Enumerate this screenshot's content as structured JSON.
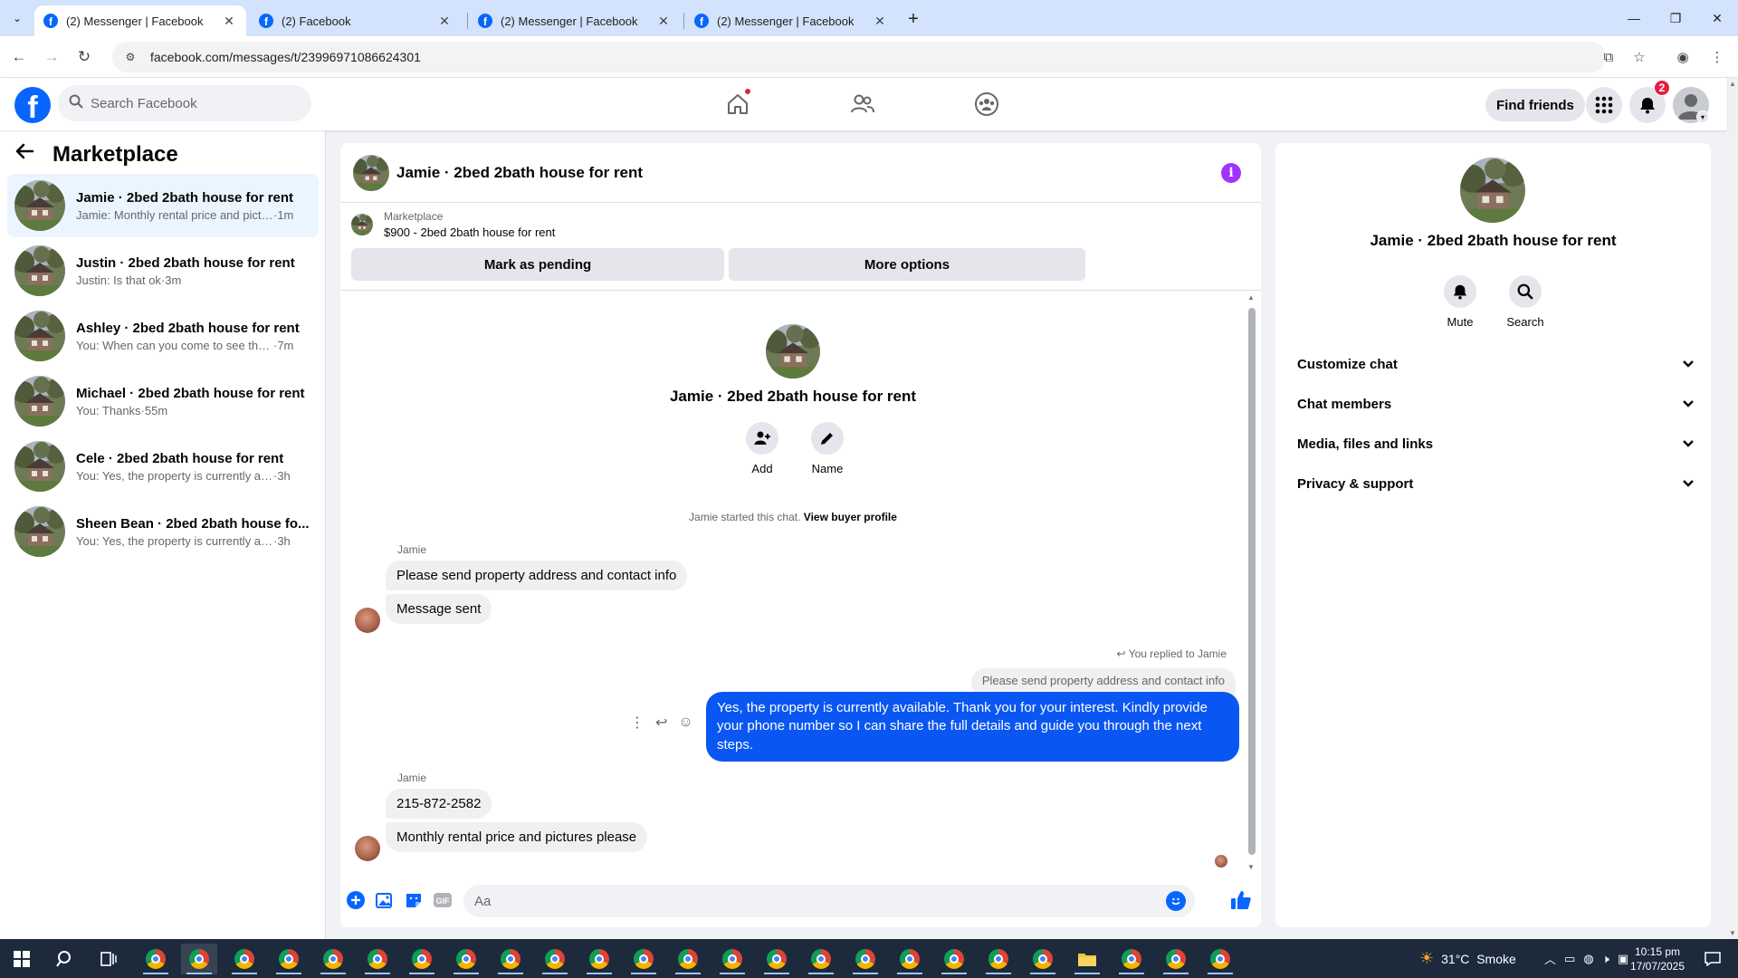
{
  "browser": {
    "tabs": [
      {
        "title": "(2) Messenger | Facebook",
        "active": true
      },
      {
        "title": "(2) Facebook",
        "active": false
      },
      {
        "title": "(2) Messenger | Facebook",
        "active": false
      },
      {
        "title": "(2) Messenger | Facebook",
        "active": false
      }
    ],
    "url": "facebook.com/messages/t/23996971086624301"
  },
  "header": {
    "search_placeholder": "Search Facebook",
    "find_friends_label": "Find friends",
    "notification_count": "2"
  },
  "sidebar": {
    "title": "Marketplace",
    "conversations": [
      {
        "name": "Jamie · 2bed 2bath house for rent",
        "preview": "Jamie: Monthly rental price and pictu...",
        "time": "·1m",
        "active": true
      },
      {
        "name": "Justin · 2bed 2bath house for rent",
        "preview": "Justin: Is that ok",
        "time": "·3m",
        "active": false
      },
      {
        "name": "Ashley · 2bed 2bath house for rent",
        "preview": "You: When can you come to see the ...",
        "time": "·7m",
        "active": false
      },
      {
        "name": "Michael · 2bed 2bath house for rent",
        "preview": "You: Thanks",
        "time": "·55m",
        "active": false
      },
      {
        "name": "Cele · 2bed 2bath house for rent",
        "preview": "You: Yes, the property is currently avail...",
        "time": "·3h",
        "active": false
      },
      {
        "name": "Sheen Bean · 2bed 2bath house fo...",
        "preview": "You: Yes, the property is currently avail...",
        "time": "·3h",
        "active": false
      }
    ]
  },
  "chat": {
    "title": "Jamie · 2bed 2bath house for rent",
    "listing_category": "Marketplace",
    "listing_price_title": "$900 - 2bed 2bath house for rent",
    "mark_pending_label": "Mark as pending",
    "more_options_label": "More options",
    "intro_title": "Jamie · 2bed 2bath house for rent",
    "add_label": "Add",
    "name_label": "Name",
    "started_text": "Jamie started this chat.",
    "view_profile_label": "View buyer profile",
    "messages": {
      "sender1": "Jamie",
      "m1": "Please send property address and contact info",
      "m2": "Message sent",
      "reply_note": "You replied to Jamie",
      "quote": "Please send property address and contact info",
      "my_reply": "Yes, the property is currently available. Thank you for your interest. Kindly provide your phone number so I can share the full details and guide you through the next steps.",
      "sender2": "Jamie",
      "m3": "215-872-2582",
      "m4": "Monthly rental price and pictures please"
    },
    "composer_placeholder": "Aa"
  },
  "details": {
    "name": "Jamie · 2bed 2bath house for rent",
    "mute_label": "Mute",
    "search_label": "Search",
    "sections": [
      "Customize chat",
      "Chat members",
      "Media, files and links",
      "Privacy & support"
    ]
  },
  "taskbar": {
    "weather": "31°C  Smoke",
    "time": "10:15 pm",
    "date": "17/07/2025"
  },
  "colors": {
    "fb_blue": "#0866ff",
    "my_bubble": "#0a56f2",
    "info_purple": "#a033ff",
    "notification_red": "#e41e3f"
  }
}
